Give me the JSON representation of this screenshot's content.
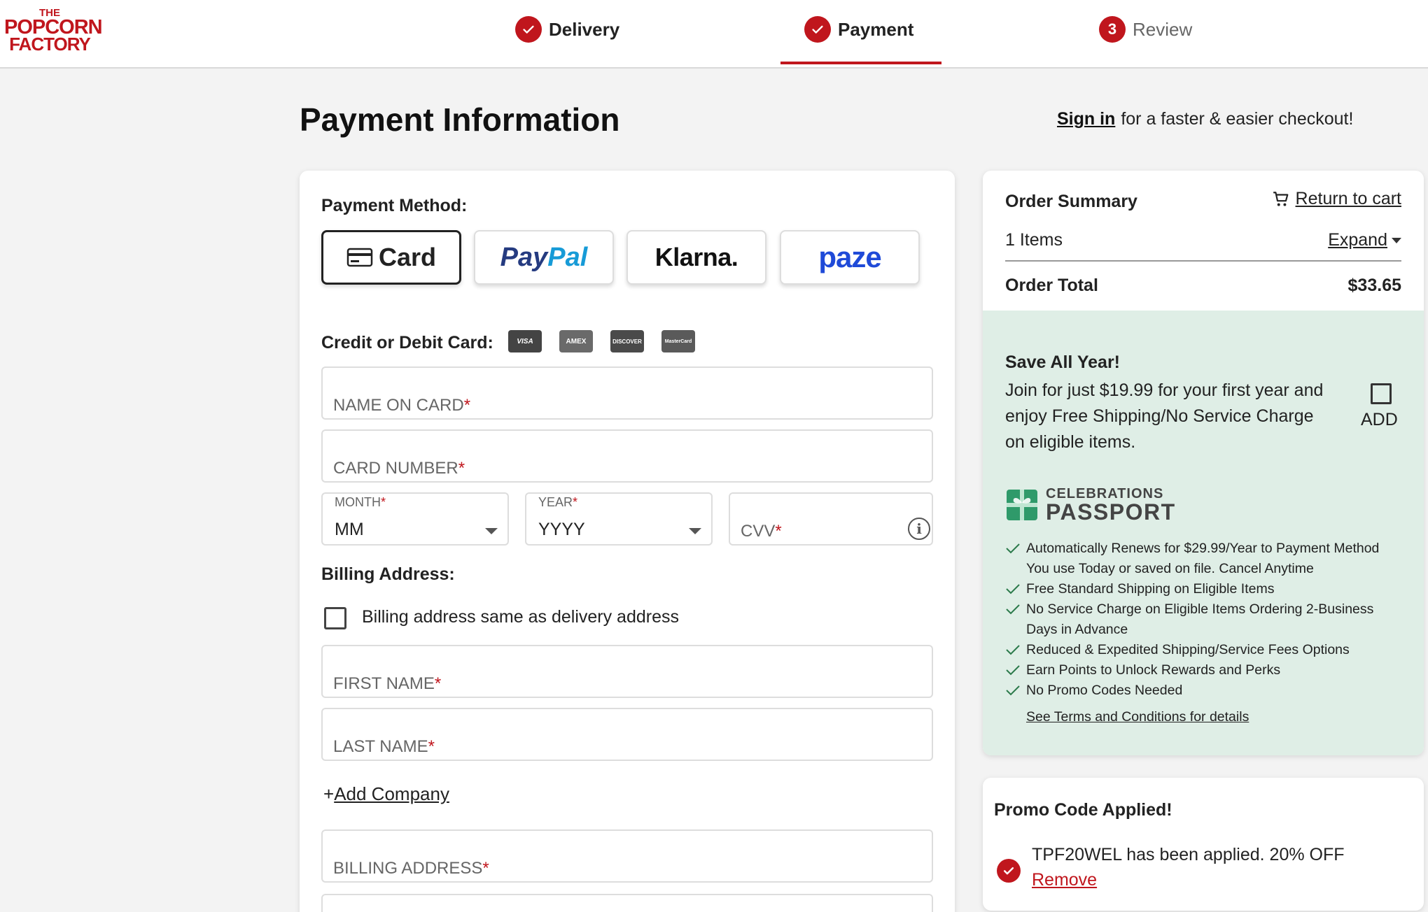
{
  "logo": {
    "line1": "THE",
    "line2": "POPCORN",
    "line3": "FACTORY"
  },
  "steps": [
    {
      "label": "Delivery",
      "state": "done"
    },
    {
      "label": "Payment",
      "state": "done"
    },
    {
      "label": "Review",
      "state": "todo",
      "number": "3"
    }
  ],
  "page_title": "Payment Information",
  "signin": {
    "link": "Sign in",
    "text": "for a faster & easier checkout!"
  },
  "payment": {
    "method_label": "Payment Method:",
    "methods": [
      {
        "label": "Card",
        "selected": true
      },
      {
        "label_a": "Pay",
        "label_b": "Pal"
      },
      {
        "label": "Klarna."
      },
      {
        "label": "paze"
      }
    ],
    "card_label": "Credit or Debit Card:",
    "card_brands": [
      "VISA",
      "AMEX",
      "DISCOVER",
      "MasterCard"
    ],
    "name_on_card": "NAME ON CARD",
    "card_number": "CARD NUMBER",
    "month_label": "MONTH",
    "month_value": "MM",
    "year_label": "YEAR",
    "year_value": "YYYY",
    "cvv": "CVV",
    "required_mark": "*"
  },
  "billing": {
    "label": "Billing Address:",
    "same_as_delivery": "Billing address same as delivery address",
    "first_name": "FIRST NAME",
    "last_name": "LAST NAME",
    "add_company_plus": "+",
    "add_company": "Add Company",
    "billing_address": "BILLING ADDRESS"
  },
  "order_summary": {
    "title": "Order Summary",
    "return_to_cart": "Return to cart",
    "items": "1 Items",
    "expand": "Expand",
    "total_label": "Order Total",
    "total_value": "$33.65"
  },
  "passport": {
    "title": "Save All Year!",
    "description": "Join for just $19.99 for your first year and enjoy Free Shipping/No Service Charge on eligible items.",
    "add_label": "ADD",
    "logo_line1": "CELEBRATIONS",
    "logo_line2": "PASSPORT",
    "benefits": [
      "Automatically Renews for $29.99/Year to Payment Method You use Today or saved on file. Cancel Anytime",
      "Free Standard Shipping on Eligible Items",
      "No Service Charge on Eligible Items Ordering 2-Business Days in Advance",
      "Reduced & Expedited Shipping/Service Fees Options",
      "Earn Points to Unlock Rewards and Perks",
      "No Promo Codes Needed"
    ],
    "terms": "See Terms and Conditions for details"
  },
  "promo": {
    "title": "Promo Code Applied!",
    "message": "TPF20WEL has been applied. 20% OFF",
    "remove": "Remove"
  },
  "colors": {
    "brand_red": "#c0161d",
    "passport_bg": "#dfeee6",
    "paypal_dark": "#253b80",
    "paypal_light": "#179bd7",
    "paze_blue": "#1f4ad8"
  }
}
